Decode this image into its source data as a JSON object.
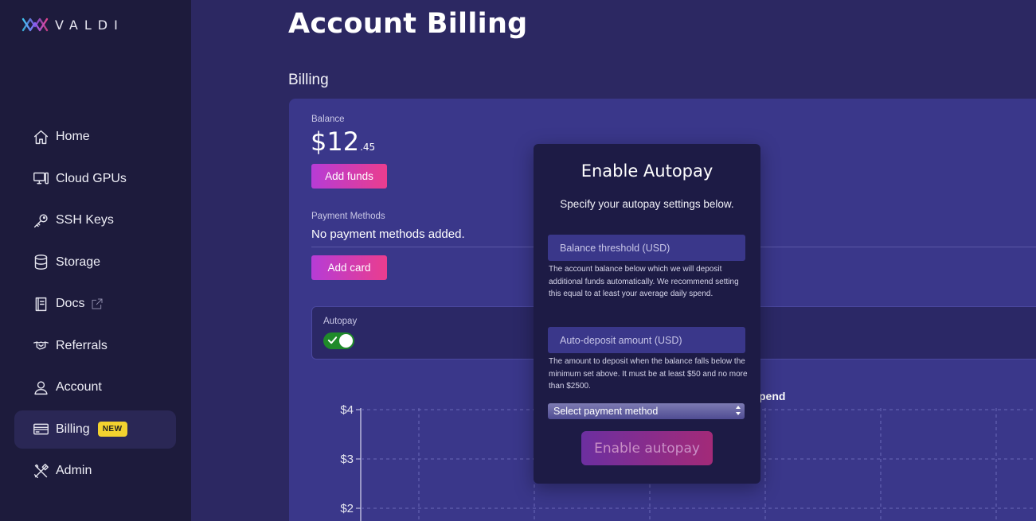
{
  "brand": {
    "name": "VALDI"
  },
  "sidebar": {
    "items": [
      {
        "label": "Home",
        "icon": "home-icon"
      },
      {
        "label": "Cloud GPUs",
        "icon": "monitor-icon"
      },
      {
        "label": "SSH Keys",
        "icon": "key-icon"
      },
      {
        "label": "Storage",
        "icon": "database-icon"
      },
      {
        "label": "Docs",
        "icon": "book-icon",
        "external": true
      },
      {
        "label": "Referrals",
        "icon": "handshake-icon"
      },
      {
        "label": "Account",
        "icon": "user-icon"
      },
      {
        "label": "Billing",
        "icon": "credit-card-icon",
        "badge": "NEW",
        "active": true
      },
      {
        "label": "Admin",
        "icon": "tools-icon"
      }
    ]
  },
  "page": {
    "title": "Account Billing",
    "section": "Billing"
  },
  "billing": {
    "balance_label": "Balance",
    "balance_dollars": "$12",
    "balance_cents": ".45",
    "add_funds_label": "Add funds",
    "payment_methods_label": "Payment Methods",
    "payment_methods_value": "No payment methods added.",
    "add_card_label": "Add card",
    "autopay_label": "Autopay",
    "autopay_enabled": true
  },
  "chart_data": {
    "type": "line",
    "title": "pend",
    "ytick_labels": [
      "$4",
      "$3",
      "$2"
    ],
    "ytick_values": [
      4,
      3,
      2
    ],
    "grid": true
  },
  "modal": {
    "title": "Enable Autopay",
    "subtitle": "Specify your autopay settings below.",
    "threshold_placeholder": "Balance threshold (USD)",
    "threshold_help": "The account balance below which we will deposit additional funds automatically. We recommend setting this equal to at least your average daily spend.",
    "deposit_placeholder": "Auto-deposit amount (USD)",
    "deposit_help": "The amount to deposit when the balance falls below the minimum set above. It must be at least $50 and no more than $2500.",
    "select_value": "Select payment method",
    "submit_label": "Enable autopay"
  },
  "colors": {
    "background": "#2c2862",
    "sidebar": "#1d1b3c",
    "card": "#3a378a",
    "modal": "#1d1b45",
    "accent_gradient_start": "#b63cd6",
    "accent_gradient_end": "#ea3d8e",
    "badge": "#f3d22f",
    "toggle_on": "#1f8a2a"
  }
}
